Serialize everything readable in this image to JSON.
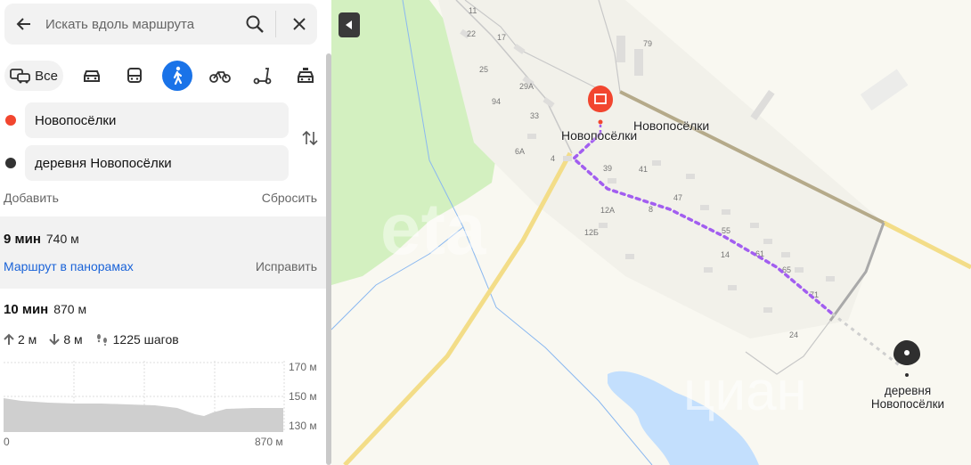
{
  "search": {
    "placeholder": "Искать вдоль маршрута"
  },
  "modes": {
    "all_label": "Все"
  },
  "waypoints": {
    "from": "Новопосёлки",
    "to": "деревня Новопосёлки"
  },
  "actions": {
    "add": "Добавить",
    "reset": "Сбросить"
  },
  "routes": [
    {
      "time": "9 мин",
      "distance": "740 м",
      "panorama_link": "Маршрут в панорамах",
      "fix_link": "Исправить"
    },
    {
      "time": "10 мин",
      "distance": "870 м",
      "ascent": "2 м",
      "descent": "8 м",
      "steps": "1225 шагов"
    }
  ],
  "elevation": {
    "ticks": [
      "170 м",
      "150 м",
      "130 м"
    ],
    "x_start": "0",
    "x_end": "870 м"
  },
  "map": {
    "place_start": "Новопосёлки",
    "place_village": "Новопосёлки",
    "place_end": "деревня Новопосёлки",
    "watermark": "циан",
    "house_numbers": [
      "11",
      "22",
      "17",
      "79",
      "25",
      "29А",
      "94",
      "33",
      "6А",
      "4",
      "39",
      "41",
      "12А",
      "8",
      "47",
      "12Б",
      "55",
      "14",
      "61",
      "65",
      "71",
      "24"
    ]
  },
  "colors": {
    "accent": "#1a73e8",
    "route": "#a25ef0",
    "start_marker": "#f2462f",
    "end_marker": "#2f2f2f",
    "forest": "#d3f0c0",
    "water": "#c3dffd"
  }
}
